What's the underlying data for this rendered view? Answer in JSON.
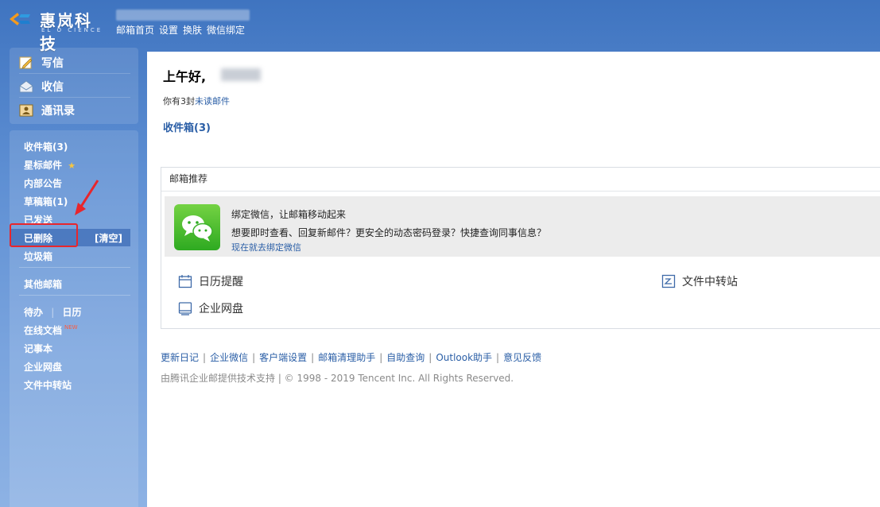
{
  "brand": {
    "name": "惠岚科技",
    "tagline": "EL O CIENCE"
  },
  "topnav": [
    {
      "label": "邮箱首页"
    },
    {
      "label": "设置"
    },
    {
      "label": "换肤"
    },
    {
      "label": "微信绑定"
    }
  ],
  "sidebar": {
    "compose": [
      {
        "label": "写信",
        "icon": "pencil-icon"
      },
      {
        "label": "收信",
        "icon": "envelope-open-icon"
      },
      {
        "label": "通讯录",
        "icon": "contacts-icon"
      }
    ],
    "folders": {
      "inbox": "收件箱(3)",
      "starred": "星标邮件",
      "internal": "内部公告",
      "drafts": "草稿箱(1)",
      "sent": "已发送",
      "deleted": "已删除",
      "clear": "[清空]",
      "spam": "垃圾箱",
      "other": "其他邮箱",
      "todo": "待办",
      "pipe": "|",
      "calendar": "日历",
      "docs": "在线文档",
      "new_badge": "NEW",
      "notes": "记事本",
      "disk": "企业网盘",
      "transfer": "文件中转站"
    }
  },
  "main": {
    "greeting": "上午好,",
    "unread_prefix": "你有3封",
    "unread_link": "未读邮件",
    "inbox_link": "收件箱(3)",
    "recommend": {
      "header": "邮箱推荐",
      "wechat_title": "绑定微信，让邮箱移动起来",
      "wechat_desc": "想要即时查看、回复新邮件？更安全的动态密码登录？快捷查询同事信息？",
      "wechat_link": "现在就去绑定微信",
      "tools": [
        {
          "label": "日历提醒",
          "icon": "calendar-icon"
        },
        {
          "label": "文件中转站",
          "icon": "file-transfer-icon"
        },
        {
          "label": "企业网盘",
          "icon": "disk-icon"
        }
      ]
    },
    "footer_links": [
      "更新日记",
      "企业微信",
      "客户端设置",
      "邮箱清理助手",
      "自助查询",
      "Outlook助手",
      "意见反馈"
    ],
    "copyright": "由腾讯企业邮提供技术支持 | © 1998 - 2019 Tencent Inc. All Rights Reserved."
  },
  "colors": {
    "accent": "#2a5ea6",
    "highlight": "#e8262c",
    "wechat_green": "#2eaa21"
  }
}
